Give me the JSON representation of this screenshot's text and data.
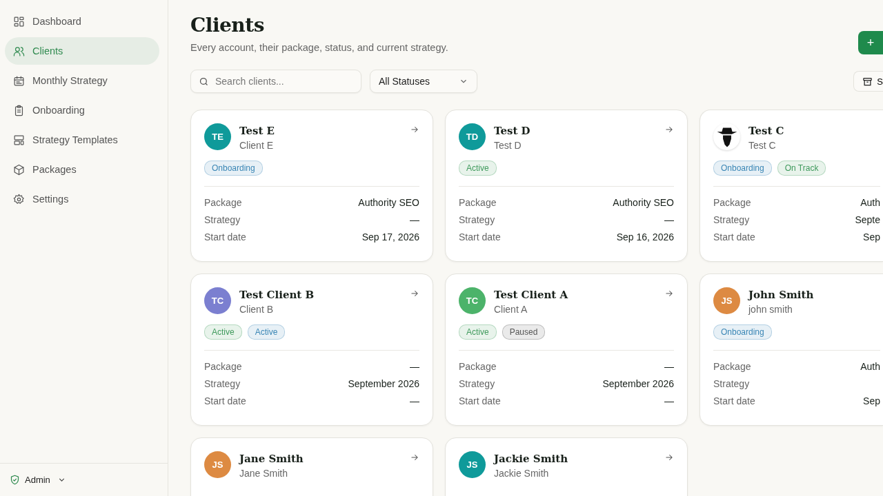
{
  "sidebar": {
    "items": [
      {
        "label": "Dashboard",
        "selected": false
      },
      {
        "label": "Clients",
        "selected": true
      },
      {
        "label": "Monthly Strategy",
        "selected": false
      },
      {
        "label": "Onboarding",
        "selected": false
      },
      {
        "label": "Strategy Templates",
        "selected": false
      },
      {
        "label": "Packages",
        "selected": false
      },
      {
        "label": "Settings",
        "selected": false
      }
    ],
    "user": {
      "label": "Admin"
    }
  },
  "header": {
    "title": "Clients",
    "subtitle": "Every account, their package, status, and current strategy.",
    "add_button": "+"
  },
  "filters": {
    "search": {
      "placeholder": "Search clients..."
    },
    "status": {
      "value": "All Statuses"
    },
    "archive_button": "S"
  },
  "cards": [
    {
      "name": "Test E",
      "subtitle": "Client E",
      "avatar": {
        "kind": "initials",
        "text": "TE",
        "color": "#0f9a9a"
      },
      "tags": [
        {
          "label": "Onboarding",
          "color": "#3a86b5"
        }
      ],
      "rows": [
        {
          "label": "Package",
          "value": "Authority SEO"
        },
        {
          "label": "Strategy",
          "value": "—"
        },
        {
          "label": "Start date",
          "value": "Sep 17, 2026"
        }
      ]
    },
    {
      "name": "Test D",
      "subtitle": "Test D",
      "avatar": {
        "kind": "initials",
        "text": "TD",
        "color": "#0f9a9a"
      },
      "tags": [
        {
          "label": "Active",
          "color": "#3f9a5c"
        }
      ],
      "rows": [
        {
          "label": "Package",
          "value": "Authority SEO"
        },
        {
          "label": "Strategy",
          "value": "—"
        },
        {
          "label": "Start date",
          "value": "Sep 16, 2026"
        }
      ]
    },
    {
      "name": "Test C",
      "subtitle": "Test C",
      "avatar": {
        "kind": "icon",
        "color": "#111111"
      },
      "tags": [
        {
          "label": "Onboarding",
          "color": "#3a86b5"
        },
        {
          "label": "On Track",
          "color": "#3f9a5c"
        }
      ],
      "rows": [
        {
          "label": "Package",
          "value": "Auth"
        },
        {
          "label": "Strategy",
          "value": "Septe"
        },
        {
          "label": "Start date",
          "value": "Sep"
        }
      ]
    },
    {
      "name": "Test Client B",
      "subtitle": "Client B",
      "avatar": {
        "kind": "initials",
        "text": "TC",
        "color": "#7b7fd0"
      },
      "tags": [
        {
          "label": "Active",
          "color": "#3f9a5c"
        },
        {
          "label": "Active",
          "color": "#3a86b5"
        }
      ],
      "rows": [
        {
          "label": "Package",
          "value": "—"
        },
        {
          "label": "Strategy",
          "value": "September 2026"
        },
        {
          "label": "Start date",
          "value": "—"
        }
      ]
    },
    {
      "name": "Test Client A",
      "subtitle": "Client A",
      "avatar": {
        "kind": "initials",
        "text": "TC",
        "color": "#4cb36a"
      },
      "tags": [
        {
          "label": "Active",
          "color": "#3f9a5c"
        },
        {
          "label": "Paused",
          "color": "#555555"
        }
      ],
      "rows": [
        {
          "label": "Package",
          "value": "—"
        },
        {
          "label": "Strategy",
          "value": "September 2026"
        },
        {
          "label": "Start date",
          "value": "—"
        }
      ]
    },
    {
      "name": "John Smith",
      "subtitle": "john smith",
      "avatar": {
        "kind": "initials",
        "text": "JS",
        "color": "#dd8a42"
      },
      "tags": [
        {
          "label": "Onboarding",
          "color": "#3a86b5"
        }
      ],
      "rows": [
        {
          "label": "Package",
          "value": "Auth"
        },
        {
          "label": "Strategy"
        },
        {
          "label": "Start date",
          "value": "Sep"
        }
      ]
    },
    {
      "name": "Jane Smith",
      "subtitle": "Jane Smith",
      "avatar": {
        "kind": "initials",
        "text": "JS",
        "color": "#dd8a42"
      }
    },
    {
      "name": "Jackie Smith",
      "subtitle": "Jackie Smith",
      "avatar": {
        "kind": "initials",
        "text": "JS",
        "color": "#0f9a9a"
      }
    }
  ]
}
